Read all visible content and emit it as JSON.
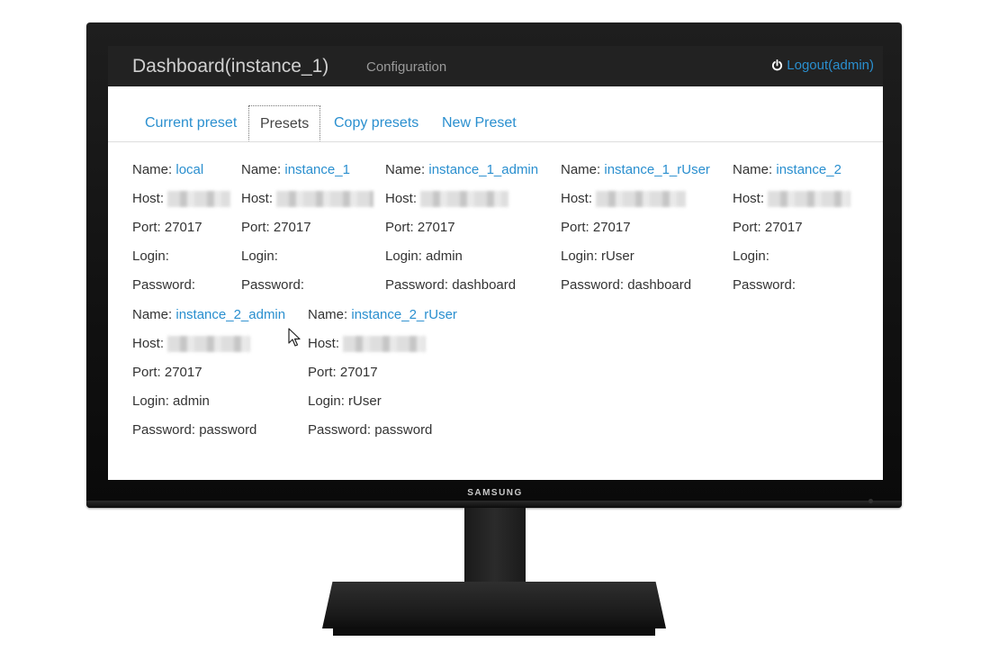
{
  "monitor": {
    "brand": "SAMSUNG"
  },
  "header": {
    "title": "Dashboard(instance_1)",
    "nav_config": "Configuration",
    "logout": "Logout(admin)"
  },
  "tabs": [
    {
      "label": "Current preset",
      "active": false
    },
    {
      "label": "Presets",
      "active": true
    },
    {
      "label": "Copy presets",
      "active": false
    },
    {
      "label": "New Preset",
      "active": false
    }
  ],
  "labels": {
    "name": "Name: ",
    "host": "Host: ",
    "port": "Port: ",
    "login": "Login: ",
    "password": "Password: "
  },
  "presets": [
    {
      "name": "local",
      "port": "27017",
      "login": "",
      "password": ""
    },
    {
      "name": "instance_1",
      "port": "27017",
      "login": "",
      "password": ""
    },
    {
      "name": "instance_1_admin",
      "port": "27017",
      "login": "admin",
      "password": "dashboard"
    },
    {
      "name": "instance_1_rUser",
      "port": "27017",
      "login": "rUser",
      "password": "dashboard"
    },
    {
      "name": "instance_2",
      "port": "27017",
      "login": "",
      "password": ""
    },
    {
      "name": "instance_2_admin",
      "port": "27017",
      "login": "admin",
      "password": "password"
    },
    {
      "name": "instance_2_rUser",
      "port": "27017",
      "login": "rUser",
      "password": "password"
    }
  ],
  "colors": {
    "link": "#2a8fcf",
    "topbar": "#222222"
  }
}
